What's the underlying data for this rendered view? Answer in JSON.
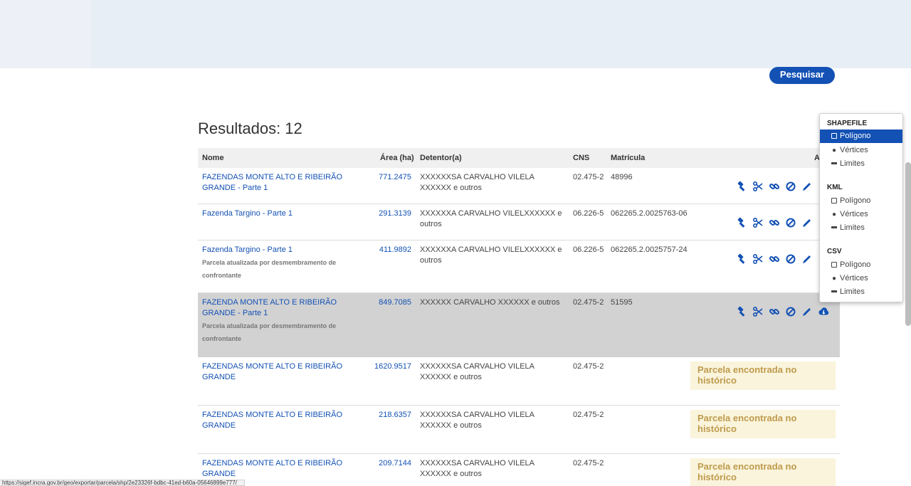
{
  "search": {
    "button_label": "Pesquisar"
  },
  "results": {
    "title": "Resultados: 12"
  },
  "table": {
    "headers": {
      "nome": "Nome",
      "area": "Área (ha)",
      "detentor": "Detentor(a)",
      "cns": "CNS",
      "matricula": "Matrícula",
      "acoes": "A"
    },
    "rows": [
      {
        "nome": "FAZENDAS MONTE ALTO E RIBEIRÃO GRANDE - Parte 1",
        "note": "",
        "area": "771.2475",
        "detentor": "XXXXXXSA CARVALHO VILELA XXXXXX e outros",
        "cns": "02.475-2",
        "matricula": "48996"
      },
      {
        "nome": "Fazenda Targino - Parte 1",
        "note": "",
        "area": "291.3139",
        "detentor": "XXXXXXA CARVALHO VILELXXXXXX e outros",
        "cns": "06.226-5",
        "matricula": "062265.2.0025763-06"
      },
      {
        "nome": "Fazenda Targino - Parte 1",
        "note": "Parcela atualizada por desmembramento de confrontante",
        "area": "411.9892",
        "detentor": "XXXXXXA CARVALHO VILELXXXXXX e outros",
        "cns": "06.226-5",
        "matricula": "062265.2.0025757-24"
      },
      {
        "nome": "FAZENDA MONTE ALTO E RIBEIRÃO GRANDE - Parte 1",
        "note": "Parcela atualizada por desmembramento de confrontante",
        "area": "849.7085",
        "detentor": "XXXXXX CARVALHO XXXXXX e outros",
        "cns": "02.475-2",
        "matricula": "51595"
      },
      {
        "nome": "FAZENDAS MONTE ALTO E RIBEIRÃO GRANDE",
        "note": "",
        "area": "1620.9517",
        "detentor": "XXXXXXSA CARVALHO VILELA XXXXXX e outros",
        "cns": "02.475-2",
        "matricula": "",
        "historico": "Parcela encontrada no histórico"
      },
      {
        "nome": "FAZENDAS MONTE ALTO E RIBEIRÃO GRANDE",
        "note": "",
        "area": "218.6357",
        "detentor": "XXXXXXSA CARVALHO VILELA XXXXXX e outros",
        "cns": "02.475-2",
        "matricula": "",
        "historico": "Parcela encontrada no histórico"
      },
      {
        "nome": "FAZENDAS MONTE ALTO E RIBEIRÃO GRANDE",
        "note": "",
        "area": "209.7144",
        "detentor": "XXXXXXSA CARVALHO VILELA XXXXXX e outros",
        "cns": "02.475-2",
        "matricula": "",
        "historico": "Parcela encontrada no histórico"
      }
    ]
  },
  "export_menu": {
    "groups": [
      {
        "title": "SHAPEFILE",
        "items": [
          "Polígono",
          "Vértices",
          "Limites"
        ],
        "active_index": 0
      },
      {
        "title": "KML",
        "items": [
          "Polígono",
          "Vértices",
          "Limites"
        ]
      },
      {
        "title": "CSV",
        "items": [
          "Polígono",
          "Vértices",
          "Limites"
        ]
      }
    ]
  },
  "statusbar": {
    "url": "https://sigef.incra.gov.br/geo/exportar/parcela/shp/2e23326f-bdbc-41ed-b60a-05646899e777/"
  },
  "colors": {
    "primary": "#1351b4",
    "selected_row": "#d2d2d2",
    "history_bg": "#faf4dc",
    "history_text": "#bf9a4c"
  },
  "icons": [
    "gavel-icon",
    "scissors-icon",
    "link-icon",
    "ban-icon",
    "pencil-icon",
    "cloud-download-icon",
    "square-icon",
    "map-marker-icon",
    "minus-icon"
  ]
}
